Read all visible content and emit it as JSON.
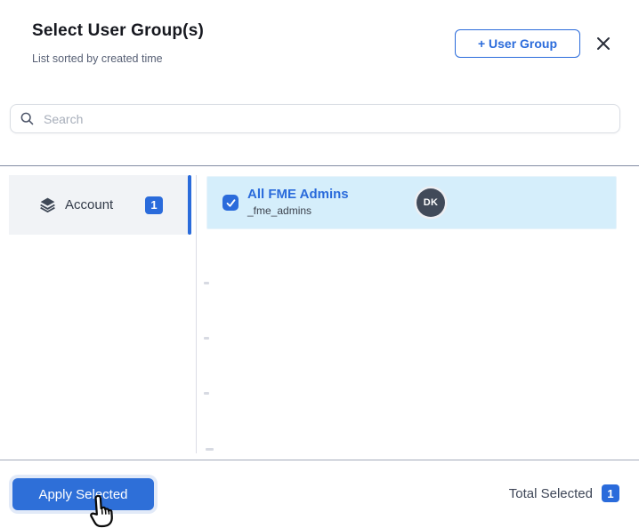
{
  "header": {
    "title": "Select User Group(s)",
    "subtitle": "List sorted by created time",
    "add_button_label": "+ User Group",
    "close_icon": "close-x"
  },
  "search": {
    "placeholder": "Search",
    "icon": "magnifier"
  },
  "sidebar": {
    "items": [
      {
        "label": "Account",
        "count": "1",
        "icon": "layers",
        "active": true
      }
    ]
  },
  "list": {
    "items": [
      {
        "name": "All FME Admins",
        "code": "_fme_admins",
        "avatar_initials": "DK",
        "selected": true
      }
    ]
  },
  "footer": {
    "apply_label": "Apply Selected",
    "total_label": "Total Selected",
    "total_count": "1"
  },
  "colors": {
    "accent_blue": "#2a6bdb",
    "apply_button_blue": "#2e6fd8",
    "selected_row_bg": "#d5eefb",
    "sidebar_item_bg": "#f1f3f6",
    "avatar_bg": "#414a59",
    "separator": "#828ca4"
  }
}
